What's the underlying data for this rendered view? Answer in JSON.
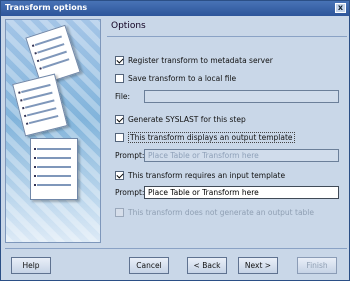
{
  "window": {
    "title": "Transform options",
    "close_glyph": "x"
  },
  "options": {
    "heading": "Options",
    "register_metadata": {
      "label": "Register transform to metadata server",
      "checked": true
    },
    "save_local": {
      "label": "Save transform to a local file",
      "checked": false
    },
    "file_label": "File:",
    "file_value": "",
    "generate_syslast": {
      "label": "Generate SYSLAST for this step",
      "checked": true
    },
    "output_template": {
      "label": "This transform displays an output template",
      "checked": false
    },
    "output_prompt_label": "Prompt:",
    "output_prompt_placeholder": "Place Table or Transform here",
    "input_template": {
      "label": "This transform requires an input template",
      "checked": true
    },
    "input_prompt_label": "Prompt:",
    "input_prompt_value": "Place Table or Transform here",
    "no_output_table": {
      "label": "This transform does not generate an output table",
      "checked": false,
      "disabled": true
    }
  },
  "buttons": {
    "help": "Help",
    "cancel": "Cancel",
    "back": "< Back",
    "next": "Next >",
    "finish": "Finish"
  }
}
